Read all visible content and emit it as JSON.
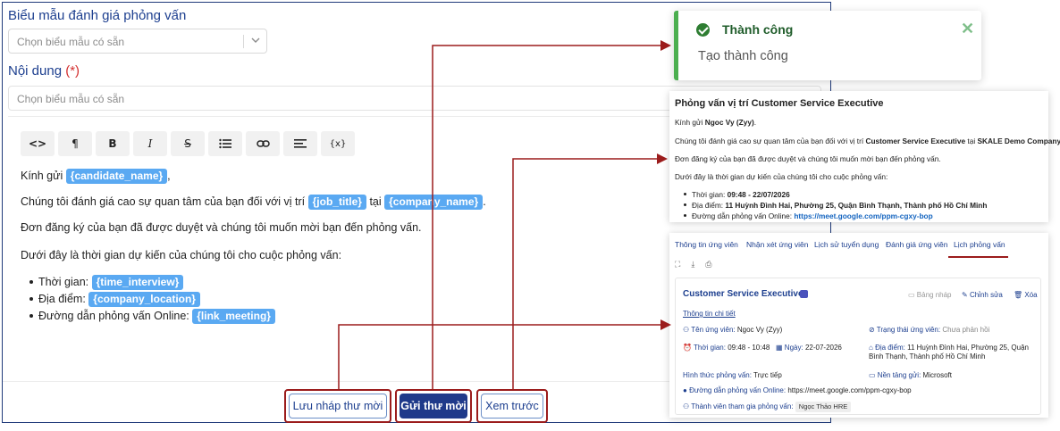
{
  "form": {
    "template_label": "Biểu mẫu đánh giá phỏng vấn",
    "template_placeholder": "Chọn biểu mẫu có sẵn",
    "content_label": "Nội dung",
    "content_required": "(*)",
    "content_placeholder": "Chọn biểu mẫu có sẵn"
  },
  "toolbar": {
    "code": "<>",
    "paragraph": "¶",
    "bold": "B",
    "italic": "I",
    "strike": "S",
    "variable": "{x}"
  },
  "editor": {
    "greeting_prefix": "Kính gửi",
    "greeting_suffix": ",",
    "tag_candidate_name": "{candidate_name}",
    "line2_prefix": "Chúng tôi đánh giá cao sự quan tâm của bạn đối với vị trí",
    "tag_job_title": "{job_title}",
    "line2_mid": "tại",
    "tag_company_name": "{company_name}",
    "line2_suffix": ".",
    "line3": "Đơn đăng ký của bạn đã được duyệt và chúng tôi muốn mời bạn đến phỏng vấn.",
    "line4": "Dưới đây là thời gian dự kiến của chúng tôi cho cuộc phỏng vấn:",
    "bullets": [
      {
        "label": "Thời gian:",
        "tag": "{time_interview}"
      },
      {
        "label": "Địa điểm:",
        "tag": "{company_location}"
      },
      {
        "label": "Đường dẫn phỏng vấn Online:",
        "tag": "{link_meeting}"
      }
    ]
  },
  "buttons": {
    "save_draft": "Lưu nháp thư mời",
    "send": "Gửi thư mời",
    "preview": "Xem trước"
  },
  "toast": {
    "title": "Thành công",
    "message": "Tạo thành công",
    "close": "✕"
  },
  "preview": {
    "title": "Phỏng vấn vị trí Customer Service Executive",
    "greeting_prefix": "Kính gửi",
    "candidate_name": "Ngoc Vy (Zyy)",
    "greeting_suffix": ".",
    "line2_prefix": "Chúng tôi đánh giá cao sự quan tâm của bạn đối với vị trí",
    "job_title": "Customer Service Executive",
    "line2_mid": "tại",
    "company": "SKALE Demo Company",
    "line2_suffix": ".",
    "line3": "Đơn đăng ký của bạn đã được duyệt và chúng tôi muốn mời bạn đến phỏng vấn.",
    "line4": "Dưới đây là thời gian dự kiến của chúng tôi cho cuộc phỏng vấn:",
    "bullets": [
      {
        "label": "Thời gian:",
        "value": "09:48 - 22/07/2026"
      },
      {
        "label": "Địa điểm:",
        "value": "11 Huỳnh Đình Hai, Phường 25, Quận Bình Thạnh, Thành phố Hồ Chí Minh"
      },
      {
        "label": "Đường dẫn phỏng vấn Online:",
        "value": "https://meet.google.com/ppm-cgxy-bop"
      }
    ]
  },
  "schedule": {
    "tabs": [
      "Thông tin ứng viên",
      "Nhận xét ứng viên",
      "Lịch sử tuyển dụng",
      "Đánh giá ứng viên",
      "Lịch phỏng vấn"
    ],
    "active_tab": "Lịch phỏng vấn",
    "card": {
      "title": "Customer Service Executive",
      "draft": "Bảng nháp",
      "edit": "Chỉnh sửa",
      "delete": "Xóa",
      "info_title": "Thông tin chi tiết",
      "candidate_label": "Tên ứng viên:",
      "candidate_value": "Ngoc Vy (Zyy)",
      "status_label": "Trạng thái ứng viên:",
      "status_value": "Chưa phản hồi",
      "time_label": "Thời gian:",
      "time_value": "09:48 - 10:48",
      "date_label": "Ngày:",
      "date_value": "22-07-2026",
      "location_label": "Địa điểm:",
      "location_value": "11 Huỳnh Đình Hai, Phường 25, Quận Bình Thạnh, Thành phố Hồ Chí Minh",
      "format_label": "Hình thức phỏng vấn:",
      "format_value": "Trực tiếp",
      "platform_label": "Nền tảng gửi:",
      "platform_value": "Microsoft",
      "link_label": "Đường dẫn phỏng vấn Online:",
      "link_value": "https://meet.google.com/ppm-cgxy-bop",
      "members_label": "Thành viên tham gia phỏng vấn:",
      "member": "Ngọc Thảo HRE"
    }
  },
  "colors": {
    "accent": "#1f3a8a",
    "tag": "#5aa9f2",
    "highlight": "#9b1c1c",
    "success": "#4caf50"
  }
}
